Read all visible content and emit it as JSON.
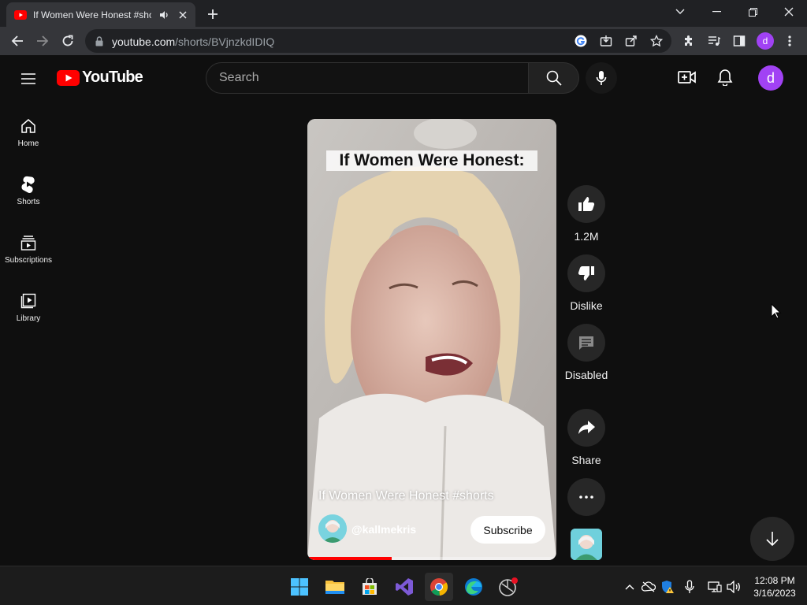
{
  "browser": {
    "tab_title": "If Women Were Honest #shorts - YouTube",
    "url_host": "youtube.com",
    "url_path": "/shorts/BVjnzkdIDIQ",
    "profile_initial": "d"
  },
  "youtube": {
    "logo_text": "YouTube",
    "search_placeholder": "Search",
    "avatar_initial": "d",
    "guide": [
      {
        "label": "Home",
        "icon": "home-icon"
      },
      {
        "label": "Shorts",
        "icon": "shorts-icon"
      },
      {
        "label": "Subscriptions",
        "icon": "subscriptions-icon"
      },
      {
        "label": "Library",
        "icon": "library-icon"
      }
    ],
    "short": {
      "overlay_text": "If Women Were Honest:",
      "title": "If Women Were Honest #shorts",
      "channel": "@kallmekris",
      "subscribe_label": "Subscribe",
      "progress": 0.34
    },
    "actions": {
      "like_label": "1.2M",
      "dislike_label": "Dislike",
      "comments_label": "Disabled",
      "share_label": "Share"
    }
  },
  "taskbar": {
    "time": "12:08 PM",
    "date": "3/16/2023"
  },
  "colors": {
    "yt_red": "#ff0000",
    "background": "#0f0f0f",
    "avatar": "#a142f4"
  }
}
